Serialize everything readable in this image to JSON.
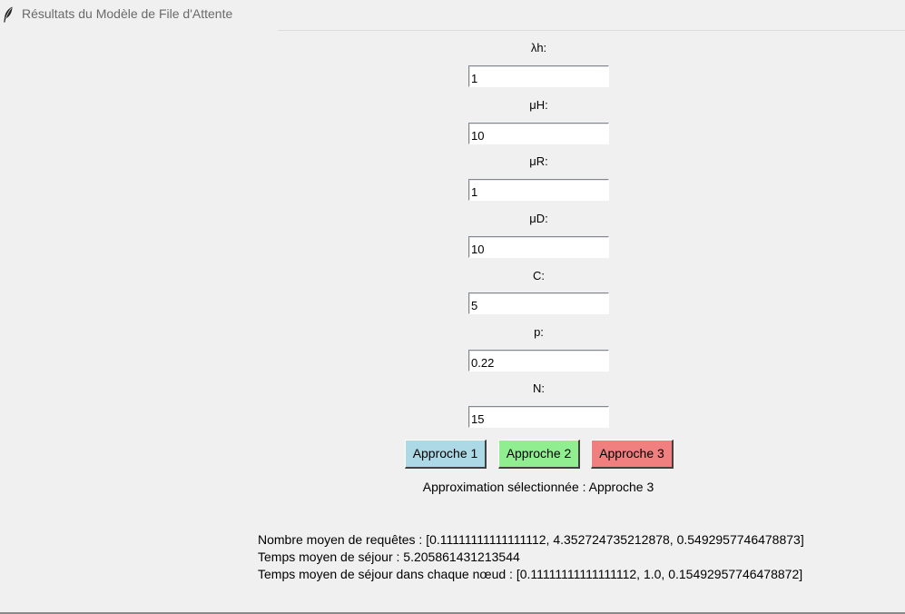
{
  "window": {
    "title": "Résultats du Modèle de File d'Attente",
    "icon": "feather-icon"
  },
  "fields": [
    {
      "label": "λh:",
      "value": "1"
    },
    {
      "label": "μH:",
      "value": "10"
    },
    {
      "label": "μR:",
      "value": "1"
    },
    {
      "label": "μD:",
      "value": "10"
    },
    {
      "label": "C:",
      "value": "5"
    },
    {
      "label": "p:",
      "value": "0.22"
    },
    {
      "label": "N:",
      "value": "15"
    }
  ],
  "buttons": [
    {
      "label": "Approche 1",
      "color": "#add8e6"
    },
    {
      "label": "Approche 2",
      "color": "#90ee90"
    },
    {
      "label": "Approche 3",
      "color": "#f08080"
    }
  ],
  "selection": "Approximation sélectionnée : Approche 3",
  "results": {
    "nombre_moyen": "Nombre moyen de requêtes : [0.11111111111111112, 4.352724735212878, 0.5492957746478873]",
    "temps_moyen": "Temps moyen de séjour : 5.205861431213544",
    "temps_noeud": "Temps moyen de séjour dans chaque nœud : [0.11111111111111112, 1.0, 0.15492957746478872]"
  }
}
